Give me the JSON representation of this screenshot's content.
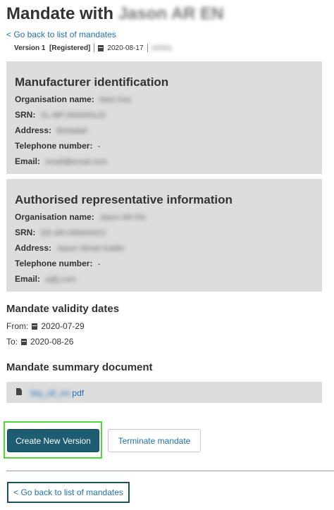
{
  "header": {
    "title_prefix": "Mandate with",
    "title_name": "Jason AR EN"
  },
  "nav": {
    "back_link": "< Go back to list of mandates",
    "back_link_bottom": "< Go back to list of mandates"
  },
  "meta": {
    "version_label": "Version",
    "version_number": "1",
    "status": "[Registered]",
    "date": "2020-08-17",
    "extra": "v00001"
  },
  "manufacturer": {
    "heading": "Manufacturer identification",
    "fields": [
      {
        "label": "Organisation name:",
        "value": "Med One"
      },
      {
        "label": "SRN:",
        "value": "XL-MF-000000123"
      },
      {
        "label": "Address:",
        "value": "Borbalah"
      },
      {
        "label": "Telephone number:",
        "value": "-"
      },
      {
        "label": "Email:",
        "value": "email@email.com"
      }
    ]
  },
  "representative": {
    "heading": "Authorised representative information",
    "fields": [
      {
        "label": "Organisation name:",
        "value": "Jason AR EN"
      },
      {
        "label": "SRN:",
        "value": "DE-AR-000000021"
      },
      {
        "label": "Address:",
        "value": "Jason Street Dublin"
      },
      {
        "label": "Telephone number:",
        "value": "-"
      },
      {
        "label": "Email:",
        "value": "a@j.com"
      }
    ]
  },
  "validity": {
    "heading": "Mandate validity dates",
    "from_label": "From:",
    "from_date": "2020-07-29",
    "to_label": "To:",
    "to_date": "2020-08-26"
  },
  "summary_doc": {
    "heading": "Mandate summary document",
    "file_name_blurred": "faq_ult_en.",
    "file_ext": "pdf"
  },
  "actions": {
    "create_label": "Create New Version",
    "terminate_label": "Terminate mandate"
  },
  "colors": {
    "primary_button": "#1e5c72",
    "focus_outline": "#4cd933",
    "link": "#1f6fb5",
    "panel_bg": "#dddddd"
  }
}
